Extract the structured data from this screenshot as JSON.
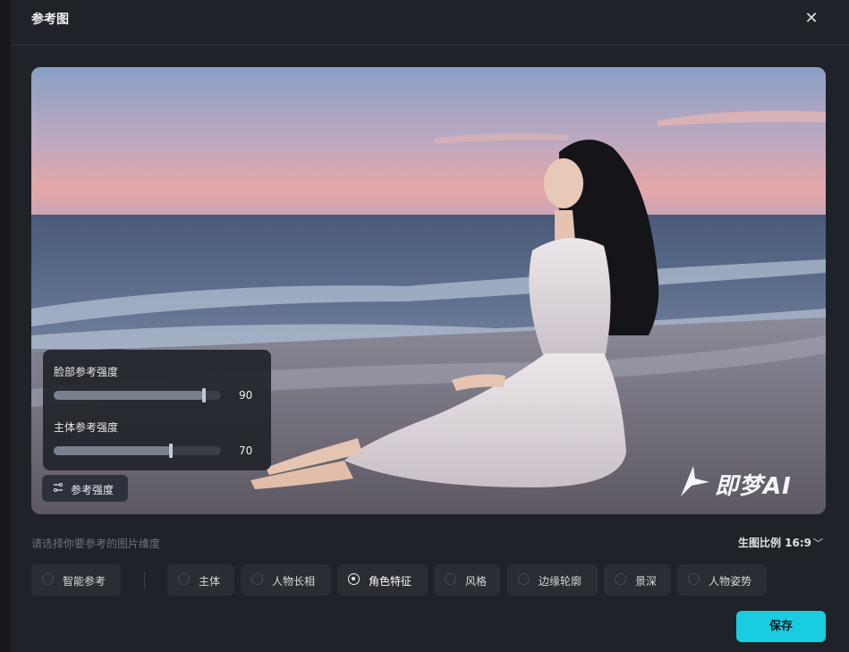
{
  "dialog": {
    "title": "参考图",
    "close_icon": "close-icon"
  },
  "panel": {
    "face": {
      "label": "脸部参考强度",
      "value": 90
    },
    "body": {
      "label": "主体参考强度",
      "value": 70
    }
  },
  "strength_button": {
    "label": "参考强度",
    "icon": "sliders-icon"
  },
  "watermark": {
    "text": "即梦AI"
  },
  "hint": "请选择你要参考的图片维度",
  "ratio": {
    "label": "生图比例 16:9"
  },
  "dimensions": [
    {
      "label": "智能参考",
      "selected": false
    },
    {
      "label": "主体",
      "selected": false
    },
    {
      "label": "人物长相",
      "selected": false
    },
    {
      "label": "角色特征",
      "selected": true
    },
    {
      "label": "风格",
      "selected": false
    },
    {
      "label": "边缘轮廓",
      "selected": false
    },
    {
      "label": "景深",
      "selected": false
    },
    {
      "label": "人物姿势",
      "selected": false
    }
  ],
  "save_label": "保存",
  "colors": {
    "accent": "#19cde0",
    "modal_bg": "#1f2228",
    "chip_bg": "#2a2d34"
  }
}
